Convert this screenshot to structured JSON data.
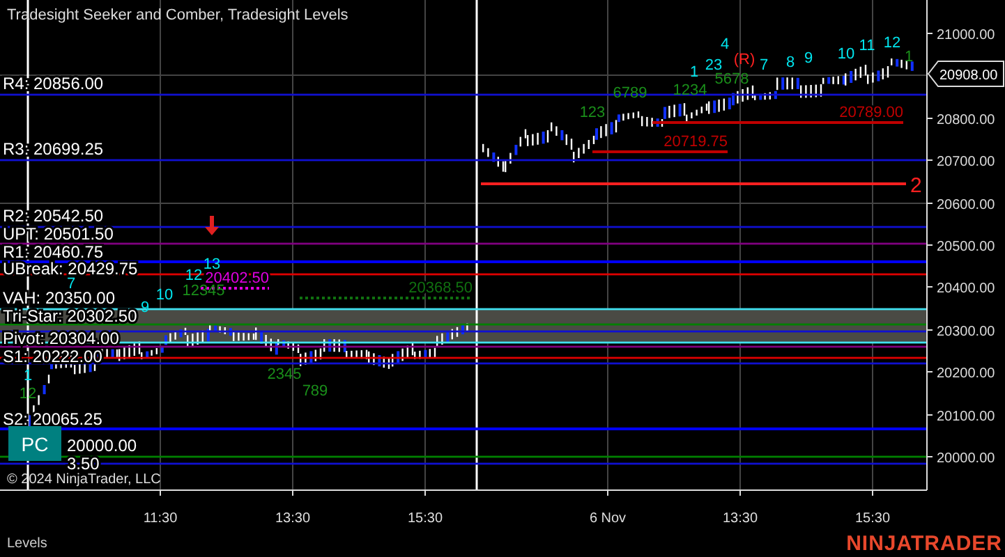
{
  "chart": {
    "title": "Tradesight Seeker and Comber, Tradesight Levels",
    "levels": [
      {
        "label": "R4: 20856.00",
        "color": "#1010d0"
      },
      {
        "label": "R3: 20699.25",
        "color": "#1010d0"
      },
      {
        "label": "R2: 20542.50",
        "color": "#1010d0"
      },
      {
        "label": "UPT: 20501.50",
        "color": "#800080"
      },
      {
        "label": "R1: 20460.75",
        "color": "#0000ff"
      },
      {
        "label": "UBreak: 20429.75",
        "color": "#e00000"
      },
      {
        "label": "VAH: 20350.00",
        "color": "#40e0f0"
      },
      {
        "label": "Tri-Star: 20302.50",
        "color": "#008000"
      },
      {
        "label": "Pivot: 20304.00",
        "color": "#1010d0"
      },
      {
        "color": "#40e0f0"
      },
      {
        "color": "#800080"
      },
      {
        "color": "#e00000"
      },
      {
        "label": "S1: 20222.00",
        "color": "#1010d0"
      },
      {
        "label": "S2: 20065.25",
        "color": "#0000ff"
      },
      {
        "label": "20000.00",
        "color": "#008000"
      },
      {
        "label": "3.50",
        "color": "#1010d0"
      }
    ],
    "price_marks": [
      {
        "text": "20402.50",
        "color": "#e000e0"
      },
      {
        "text": "20368.50",
        "color": "#107010"
      },
      {
        "text": "20719.75",
        "color": "#c00000"
      },
      {
        "text": "20789.00",
        "color": "#c00000"
      },
      {
        "text": "2",
        "color": "#ff2020"
      }
    ],
    "counts": [
      {
        "text": "13",
        "color": "#00e5ee"
      },
      {
        "text": "12",
        "color": "#00e5ee"
      },
      {
        "text": "7",
        "color": "#00e5ee"
      },
      {
        "text": "10",
        "color": "#00e5ee"
      },
      {
        "text": "12345",
        "color": "#1a8f1a"
      },
      {
        "text": "9",
        "color": "#00e5ee"
      },
      {
        "text": "1",
        "color": "#00e5ee"
      },
      {
        "text": "12",
        "color": "#1a8f1a"
      },
      {
        "text": "2345",
        "color": "#1a8f1a"
      },
      {
        "text": "789",
        "color": "#1a8f1a"
      },
      {
        "text": "123",
        "color": "#1a8f1a"
      },
      {
        "text": "6789",
        "color": "#1a8f1a"
      },
      {
        "text": "1234",
        "color": "#1a8f1a"
      },
      {
        "text": "5678",
        "color": "#1a8f1a"
      },
      {
        "text": "1",
        "color": "#00e5ee"
      },
      {
        "text": "23",
        "color": "#00e5ee"
      },
      {
        "text": "(R)",
        "color": "#ff2020"
      },
      {
        "text": "4",
        "color": "#00e5ee"
      },
      {
        "text": "7",
        "color": "#00e5ee"
      },
      {
        "text": "8",
        "color": "#00e5ee"
      },
      {
        "text": "9",
        "color": "#00e5ee"
      },
      {
        "text": "10",
        "color": "#00e5ee"
      },
      {
        "text": "11",
        "color": "#00e5ee"
      },
      {
        "text": "12",
        "color": "#00e5ee"
      },
      {
        "text": "1",
        "color": "#1a8f1a"
      }
    ],
    "y_axis": [
      "21000.00",
      "20800.00",
      "20700.00",
      "20600.00",
      "20500.00",
      "20400.00",
      "20300.00",
      "20200.00",
      "20100.00",
      "20000.00"
    ],
    "x_axis": [
      "11:30",
      "13:30",
      "15:30",
      "6 Nov",
      "13:30",
      "15:30"
    ],
    "current_price": "20908.00",
    "badge": "PC",
    "copyright": "© 2024 NinjaTrader, LLC"
  },
  "bottom_tab": "Levels",
  "logo": "NINJATRADER"
}
